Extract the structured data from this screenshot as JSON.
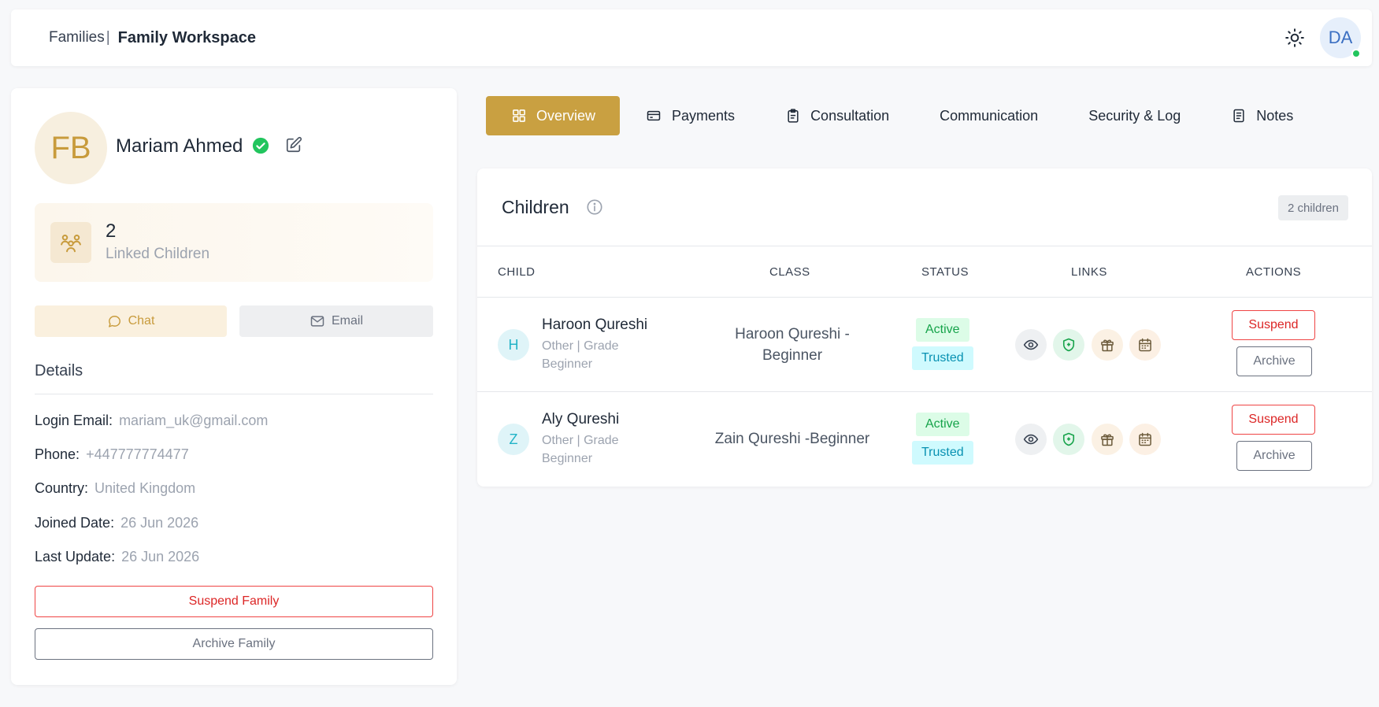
{
  "header": {
    "breadcrumb_parent": "Families",
    "breadcrumb_separator": "|",
    "breadcrumb_current": "Family Workspace",
    "user_initials": "DA"
  },
  "profile": {
    "initials": "FB",
    "name": "Mariam Ahmed",
    "stat_value": "2",
    "stat_label": "Linked Children",
    "chat_label": "Chat",
    "email_label": "Email",
    "details_title": "Details",
    "details": [
      {
        "label": "Login Email:",
        "value": "mariam_uk@gmail.com"
      },
      {
        "label": "Phone:",
        "value": "+447777774477"
      },
      {
        "label": "Country:",
        "value": "United Kingdom"
      },
      {
        "label": "Joined Date:",
        "value": "26 Jun 2026"
      },
      {
        "label": "Last Update:",
        "value": "26 Jun 2026"
      }
    ],
    "suspend_label": "Suspend Family",
    "archive_label": "Archive Family"
  },
  "tabs": [
    {
      "label": "Overview",
      "icon": "grid-icon",
      "active": true
    },
    {
      "label": "Payments",
      "icon": "card-icon"
    },
    {
      "label": "Consultation",
      "icon": "clipboard-icon"
    },
    {
      "label": "Communication"
    },
    {
      "label": "Security & Log"
    },
    {
      "label": "Notes",
      "icon": "document-icon"
    }
  ],
  "children": {
    "title": "Children",
    "count_badge": "2 children",
    "columns": [
      "CHILD",
      "CLASS",
      "STATUS",
      "LINKS",
      "ACTIONS"
    ],
    "rows": [
      {
        "initial": "H",
        "name": "Haroon Qureshi",
        "sub": "Other | Grade Beginner",
        "class": "Haroon Qureshi - Beginner",
        "status_active": "Active",
        "status_trusted": "Trusted",
        "suspend_label": "Suspend",
        "archive_label": "Archive"
      },
      {
        "initial": "Z",
        "name": "Aly Qureshi",
        "sub": "Other | Grade Beginner",
        "class": "Zain Qureshi -Beginner",
        "status_active": "Active",
        "status_trusted": "Trusted",
        "suspend_label": "Suspend",
        "archive_label": "Archive"
      }
    ]
  },
  "colors": {
    "accent": "#c9a041",
    "danger": "#dc2626",
    "success": "#16a34a",
    "info": "#0891b2"
  }
}
